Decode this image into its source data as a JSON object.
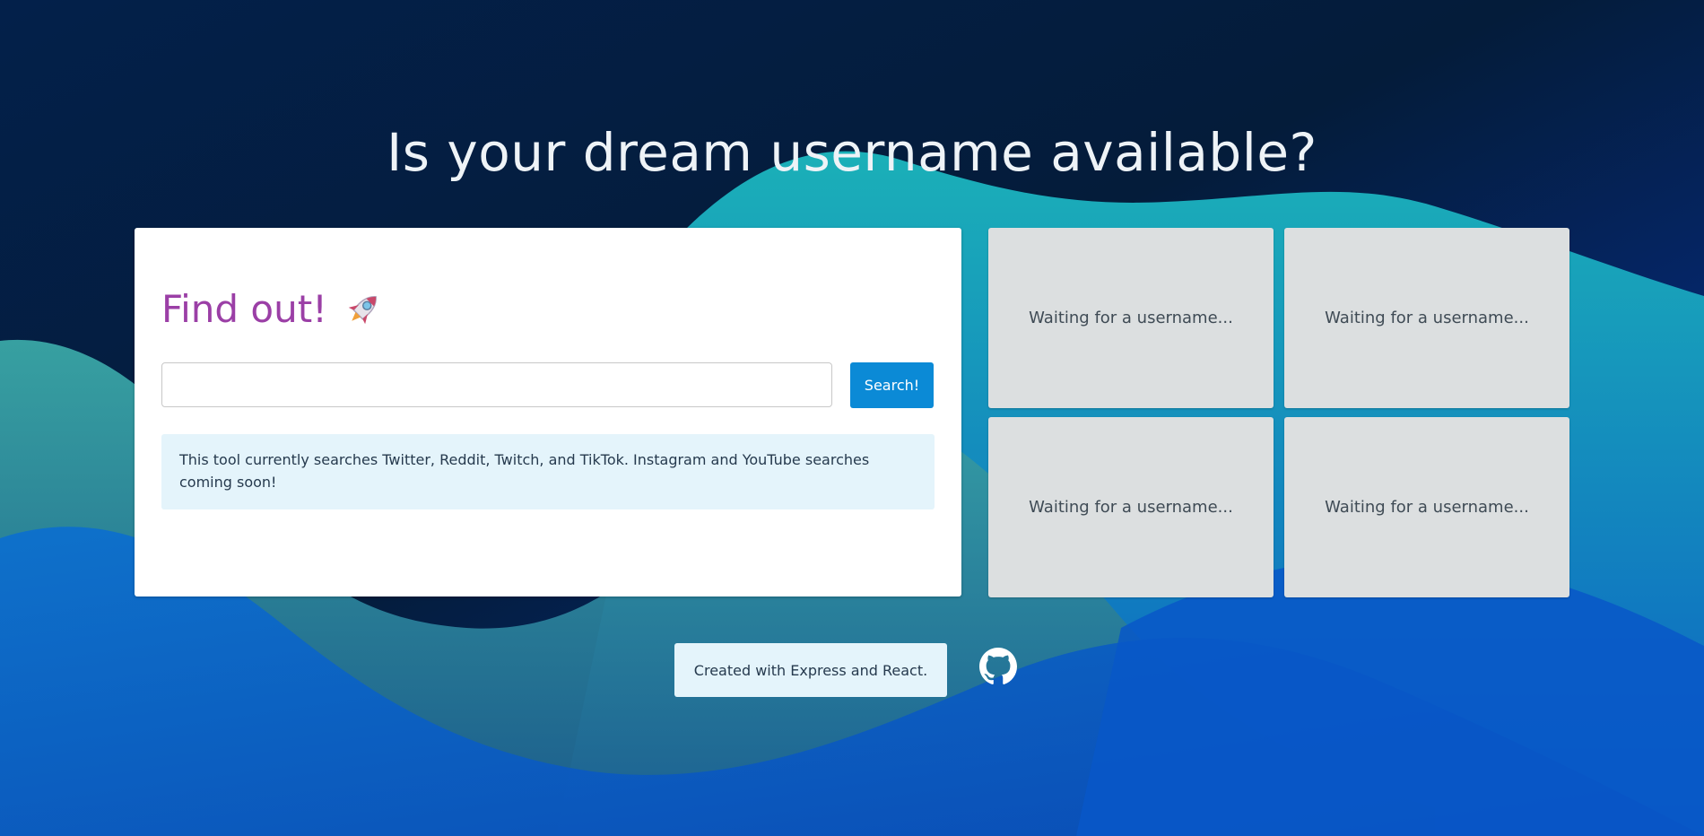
{
  "page": {
    "title": "Is your dream username available?"
  },
  "search_card": {
    "heading": "Find out!",
    "heading_icon": "rocket-icon",
    "input_value": "",
    "input_placeholder": "",
    "button_label": "Search!",
    "info_text": "This tool currently searches Twitter, Reddit, Twitch, and TikTok. Instagram and YouTube searches coming soon!"
  },
  "results": [
    {
      "status": "Waiting for a username..."
    },
    {
      "status": "Waiting for a username..."
    },
    {
      "status": "Waiting for a username..."
    },
    {
      "status": "Waiting for a username..."
    }
  ],
  "footer": {
    "credit": "Created with Express and React.",
    "github_icon": "github-icon"
  },
  "colors": {
    "heading_purple": "#9b3fa6",
    "button_blue": "#0b8ad6",
    "info_bg": "#e4f4fb",
    "tile_bg": "#dcdfe0"
  }
}
